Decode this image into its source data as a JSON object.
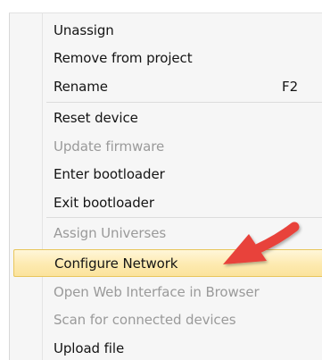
{
  "menu": {
    "items": [
      {
        "label": "Unassign",
        "enabled": true
      },
      {
        "label": "Remove from project",
        "enabled": true
      },
      {
        "label": "Rename",
        "shortcut": "F2",
        "enabled": true
      },
      {
        "label": "Reset device",
        "enabled": true
      },
      {
        "label": "Update firmware",
        "enabled": false
      },
      {
        "label": "Enter bootloader",
        "enabled": true
      },
      {
        "label": "Exit bootloader",
        "enabled": true
      },
      {
        "label": "Assign Universes",
        "enabled": false
      },
      {
        "label": "Configure Network",
        "enabled": true,
        "highlighted": true
      },
      {
        "label": "Open Web Interface in Browser",
        "enabled": false
      },
      {
        "label": "Scan for connected devices",
        "enabled": false
      },
      {
        "label": "Upload file",
        "enabled": true
      }
    ]
  },
  "annotation": {
    "arrow_color": "#e8433a",
    "points_to": "Configure Network"
  },
  "colors": {
    "menu_background": "#f6f6f6",
    "highlight": "#fdeab0",
    "highlight_border": "#e8c65c",
    "disabled_text": "#9a9a9a"
  }
}
